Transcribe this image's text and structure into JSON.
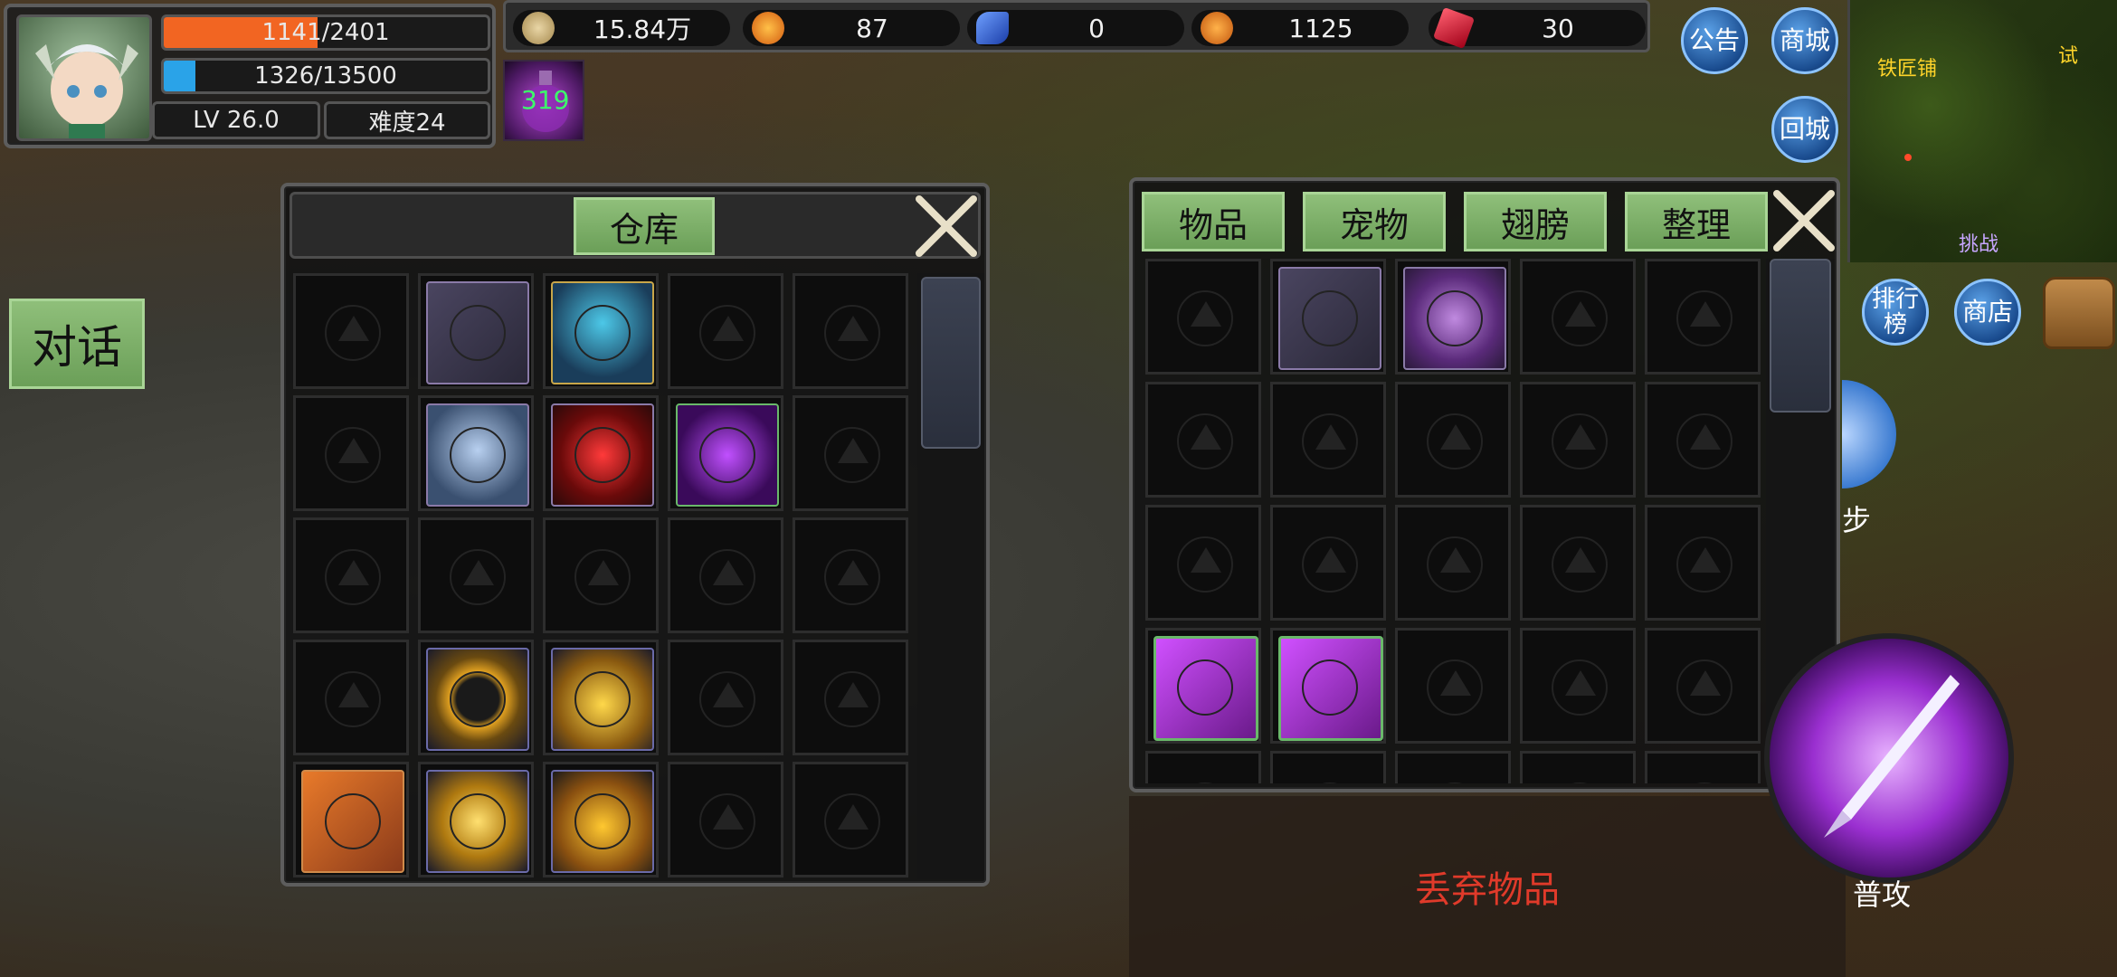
{
  "player": {
    "hp_text": "1141/2401",
    "hp_fraction": 0.475,
    "mp_text": "1326/13500",
    "mp_fraction": 0.098,
    "level_text": "LV  26.0",
    "difficulty_text": "难度24"
  },
  "resources": [
    {
      "icon": "coin-icon",
      "value": "15.84万",
      "color": "#d8c08a"
    },
    {
      "icon": "flame-crystal-icon",
      "value": "87",
      "color": "#e88a1a"
    },
    {
      "icon": "blue-feather-icon",
      "value": "0",
      "color": "#3a6be0"
    },
    {
      "icon": "runner-icon",
      "value": "1125",
      "color": "#e8901c"
    },
    {
      "icon": "ruby-icon",
      "value": "30",
      "color": "#d01c2c"
    }
  ],
  "potion": {
    "count": "319"
  },
  "top_buttons": {
    "announcement": "公告",
    "shop_mall": "商城",
    "return_city": "回城"
  },
  "minimap": {
    "label_smith": "铁匠铺",
    "label_challenge": "挑战",
    "label_partial": "试"
  },
  "side_buttons": {
    "ranking": "排行榜",
    "store": "商店"
  },
  "talk_button": "对话",
  "warehouse": {
    "title": "仓库",
    "slots": [
      [
        "",
        "spear",
        "blue-mage",
        "",
        ""
      ],
      [
        "",
        "armor",
        "red-amulet",
        "purple-dagger",
        ""
      ],
      [
        "",
        "",
        "",
        "",
        ""
      ],
      [
        "",
        "gold-ring",
        "gold-necklace",
        "",
        ""
      ],
      [
        "orange-scroll",
        "gold-orb-ring",
        "gold-helmet",
        "",
        ""
      ]
    ]
  },
  "inventory": {
    "tabs": [
      "物品",
      "宠物",
      "翅膀",
      "整理"
    ],
    "slots": [
      [
        "",
        "spear",
        "purple-helmet",
        "",
        ""
      ],
      [
        "",
        "",
        "",
        "",
        ""
      ],
      [
        "",
        "",
        "",
        "",
        ""
      ],
      [
        "purple-scroll",
        "purple-scroll",
        "",
        "",
        ""
      ]
    ]
  },
  "discard_label": "丢弃物品",
  "skill_partial": "步",
  "attack_label": "普攻",
  "colors": {
    "hp": "#f26522",
    "mp": "#2aa3e8",
    "tab_green": "#7aac66",
    "discard_red": "#e03a2a"
  }
}
